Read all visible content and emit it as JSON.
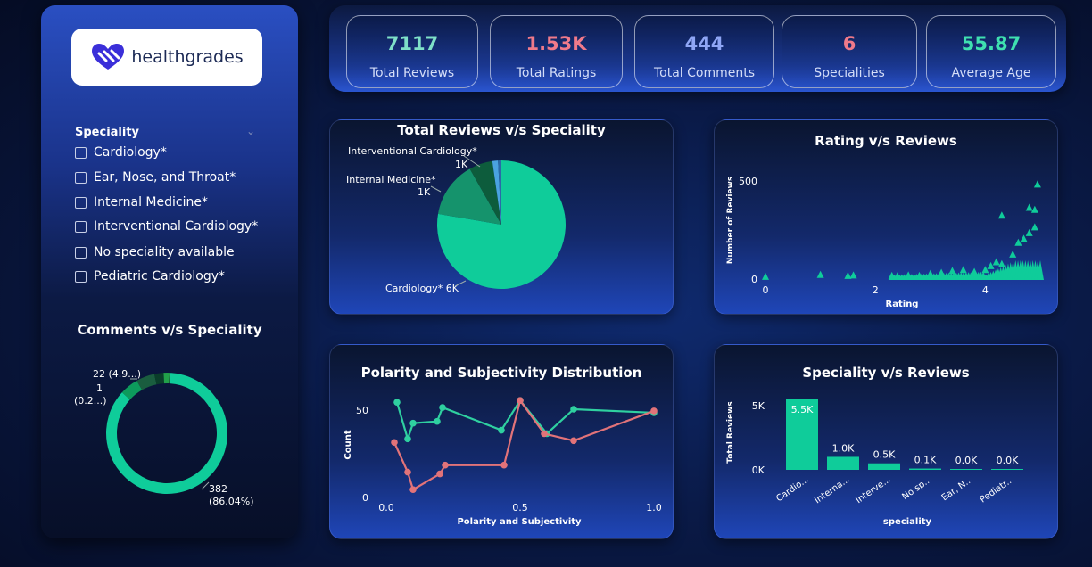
{
  "logo": {
    "text": "healthgrades",
    "brand_color": "#3b2fd9"
  },
  "kpis": [
    {
      "value": "7117",
      "label": "Total Reviews",
      "color": "#7ee0c8"
    },
    {
      "value": "1.53K",
      "label": "Total Ratings",
      "color": "#f07a8a"
    },
    {
      "value": "444",
      "label": "Total Comments",
      "color": "#8fa6f5"
    },
    {
      "value": "6",
      "label": "Specialities",
      "color": "#f07a8a"
    },
    {
      "value": "55.87",
      "label": "Average Age",
      "color": "#3fe0b0"
    }
  ],
  "slicer": {
    "title": "Speciality",
    "items": [
      "Cardiology*",
      "Ear, Nose, and Throat*",
      "Internal Medicine*",
      "Interventional Cardiology*",
      "No speciality available",
      "Pediatric Cardiology*"
    ]
  },
  "colors": {
    "teal": "#0fcc9a",
    "pink": "#e27379",
    "dark_green": "#0d5c3c",
    "mid_green": "#15936c",
    "blue": "#4aa3e0"
  },
  "chart_data": [
    {
      "id": "comments",
      "type": "pie",
      "title": "Comments v/s Speciality",
      "donut": true,
      "slices": [
        {
          "value": 382,
          "label": "382",
          "sublabel": "(86.04%)",
          "color": "#0fcc9a"
        },
        {
          "value": 22,
          "label": "22 (4.9...)",
          "sublabel": "",
          "color": "#0d9a5c"
        },
        {
          "value": 22,
          "label": "",
          "sublabel": "",
          "color": "#1a5d3f"
        },
        {
          "value": 11,
          "label": "",
          "sublabel": "",
          "color": "#0a3e2a"
        },
        {
          "value": 7,
          "label": "",
          "sublabel": "",
          "color": "#22a04a"
        },
        {
          "value": 1,
          "label": "1",
          "sublabel": "(0.2...)",
          "color": "#0a2a1e"
        }
      ]
    },
    {
      "id": "reviews_pie",
      "type": "pie",
      "title": "Total Reviews v/s Speciality",
      "slices": [
        {
          "value": 5500,
          "label": "Cardiology* 6K",
          "color": "#0fcc9a"
        },
        {
          "value": 1000,
          "label": "Internal Medicine*",
          "value_label": "1K",
          "color": "#15936c"
        },
        {
          "value": 420,
          "label": "Interventional Cardiology*",
          "value_label": "1K",
          "color": "#0d5c3c"
        },
        {
          "value": 100,
          "label": "",
          "color": "#4aa3e0"
        },
        {
          "value": 60,
          "label": "",
          "color": "#2a6aa8"
        }
      ]
    },
    {
      "id": "rating_reviews",
      "type": "scatter",
      "title": "Rating v/s Reviews",
      "xlabel": "Rating",
      "ylabel": "Number of Reviews",
      "xticks": [
        "0",
        "2",
        "4"
      ],
      "yticks": [
        "0",
        "500"
      ],
      "xlim": [
        0,
        5
      ],
      "ylim": [
        0,
        500
      ],
      "points": [
        [
          0,
          5
        ],
        [
          1,
          15
        ],
        [
          1.5,
          10
        ],
        [
          1.6,
          12
        ],
        [
          2.3,
          10
        ],
        [
          2.4,
          8
        ],
        [
          2.6,
          12
        ],
        [
          2.8,
          10
        ],
        [
          3.0,
          20
        ],
        [
          3.2,
          25
        ],
        [
          3.4,
          35
        ],
        [
          3.6,
          40
        ],
        [
          3.8,
          30
        ],
        [
          4.0,
          40
        ],
        [
          4.1,
          60
        ],
        [
          4.2,
          80
        ],
        [
          4.3,
          70
        ],
        [
          4.5,
          120
        ],
        [
          4.6,
          180
        ],
        [
          4.7,
          200
        ],
        [
          4.8,
          230
        ],
        [
          4.9,
          260
        ],
        [
          4.3,
          320
        ],
        [
          4.8,
          360
        ],
        [
          4.9,
          350
        ],
        [
          4.95,
          480
        ]
      ]
    },
    {
      "id": "polarity",
      "type": "line",
      "title": "Polarity and Subjectivity Distribution",
      "xlabel": "Polarity and Subjectivity",
      "ylabel": "Count",
      "xticks": [
        "0.0",
        "0.5",
        "1.0"
      ],
      "yticks": [
        "50",
        "0"
      ],
      "xlim": [
        0,
        1
      ],
      "ylim": [
        0,
        50
      ],
      "series": [
        {
          "color": "#2fd0a0",
          "points": [
            [
              0.04,
              54
            ],
            [
              0.08,
              33
            ],
            [
              0.1,
              42
            ],
            [
              0.19,
              43
            ],
            [
              0.21,
              51
            ],
            [
              0.43,
              38
            ],
            [
              0.5,
              55
            ],
            [
              0.6,
              36
            ],
            [
              0.7,
              50
            ],
            [
              1.0,
              48
            ]
          ]
        },
        {
          "color": "#e27379",
          "points": [
            [
              0.03,
              31
            ],
            [
              0.08,
              14
            ],
            [
              0.1,
              4
            ],
            [
              0.2,
              13
            ],
            [
              0.22,
              18
            ],
            [
              0.44,
              18
            ],
            [
              0.5,
              55
            ],
            [
              0.59,
              36
            ],
            [
              0.7,
              32
            ],
            [
              1.0,
              49
            ]
          ]
        }
      ]
    },
    {
      "id": "speciality_reviews",
      "type": "bar",
      "title": "Speciality v/s Reviews",
      "xlabel": "speciality",
      "ylabel": "Total Reviews",
      "yticks": [
        "5K",
        "0K"
      ],
      "ylim": [
        0,
        5500
      ],
      "categories": [
        "Cardio...",
        "Interna...",
        "Interve...",
        "No sp...",
        "Ear, N...",
        "Pediatr..."
      ],
      "values": [
        5500,
        1000,
        500,
        100,
        20,
        10
      ],
      "value_labels": [
        "5.5K",
        "1.0K",
        "0.5K",
        "0.1K",
        "0.0K",
        "0.0K"
      ]
    }
  ]
}
